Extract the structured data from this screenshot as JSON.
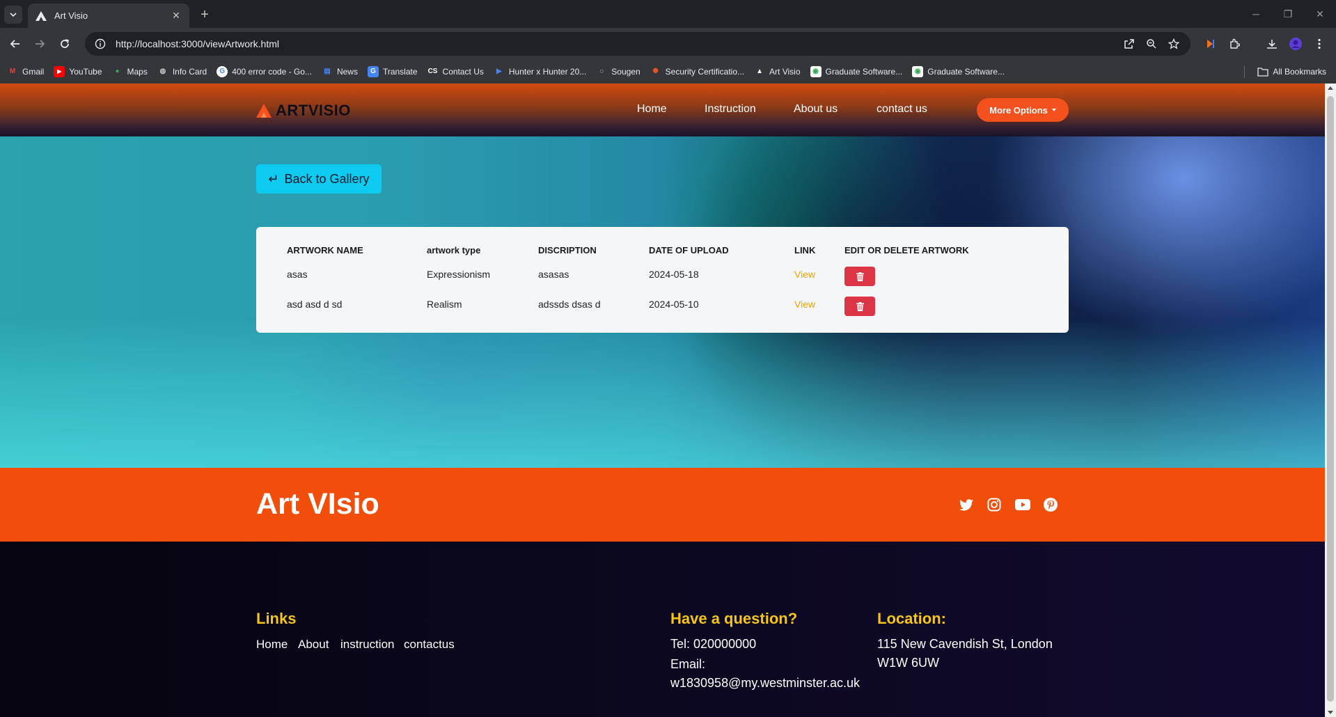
{
  "browser": {
    "tab_title": "Art Visio",
    "url": "http://localhost:3000/viewArtwork.html",
    "bookmarks": [
      {
        "label": "Gmail",
        "icon": "gmail-icon",
        "color": "#ea4335"
      },
      {
        "label": "YouTube",
        "icon": "youtube-icon",
        "color": "#ff0000"
      },
      {
        "label": "Maps",
        "icon": "maps-icon",
        "color": "#34a853"
      },
      {
        "label": "Info Card",
        "icon": "globe-icon",
        "color": "#9aa0a6"
      },
      {
        "label": "400 error code - Go...",
        "icon": "google-icon",
        "color": "#ffffff"
      },
      {
        "label": "News",
        "icon": "news-icon",
        "color": "#4285f4"
      },
      {
        "label": "Translate",
        "icon": "translate-icon",
        "color": "#4285f4"
      },
      {
        "label": "Contact Us",
        "icon": "contact-icon",
        "color": "#ffffff"
      },
      {
        "label": "Hunter x Hunter 20...",
        "icon": "play-icon",
        "color": "#4285f4"
      },
      {
        "label": "Sougen",
        "icon": "loading-icon",
        "color": "#ffffff"
      },
      {
        "label": "Security Certificatio...",
        "icon": "security-icon",
        "color": "#e8552b"
      },
      {
        "label": "Art Visio",
        "icon": "artvisio-icon",
        "color": "#ffffff"
      },
      {
        "label": "Graduate Software...",
        "icon": "graduate-icon",
        "color": "#fbbc04"
      },
      {
        "label": "Graduate Software...",
        "icon": "graduate-icon",
        "color": "#fbbc04"
      }
    ],
    "all_bookmarks": "All Bookmarks"
  },
  "header": {
    "logo_text": "ARTVISIO",
    "nav": [
      "Home",
      "Instruction",
      "About us",
      "contact us"
    ],
    "more_options": "More Options",
    "accent": "#f4511e"
  },
  "main": {
    "back_button": "Back to Gallery",
    "table": {
      "headers": [
        "ARTWORK NAME",
        "artwork type",
        "DISCRIPTION",
        "DATE OF UPLOAD",
        "LINK",
        "EDIT OR DELETE ARTWORK"
      ],
      "rows": [
        {
          "name": "asas",
          "type": "Expressionism",
          "description": "asasas",
          "date": "2024-05-18",
          "link": "View"
        },
        {
          "name": "asd asd d sd",
          "type": "Realism",
          "description": "adssds dsas d",
          "date": "2024-05-10",
          "link": "View"
        }
      ]
    }
  },
  "footer": {
    "brand": "Art VIsio",
    "social": [
      "twitter-icon",
      "instagram-icon",
      "youtube-icon",
      "pinterest-icon"
    ],
    "links_heading": "Links",
    "links": [
      "Home",
      "About",
      "instruction",
      "contactus"
    ],
    "question_heading": "Have a question?",
    "tel": "Tel: 020000000",
    "email_label": "Email:",
    "email": "w1830958@my.westminster.ac.uk",
    "location_heading": "Location:",
    "address_line1": "115 New Cavendish St, London",
    "address_line2": "W1W 6UW"
  }
}
